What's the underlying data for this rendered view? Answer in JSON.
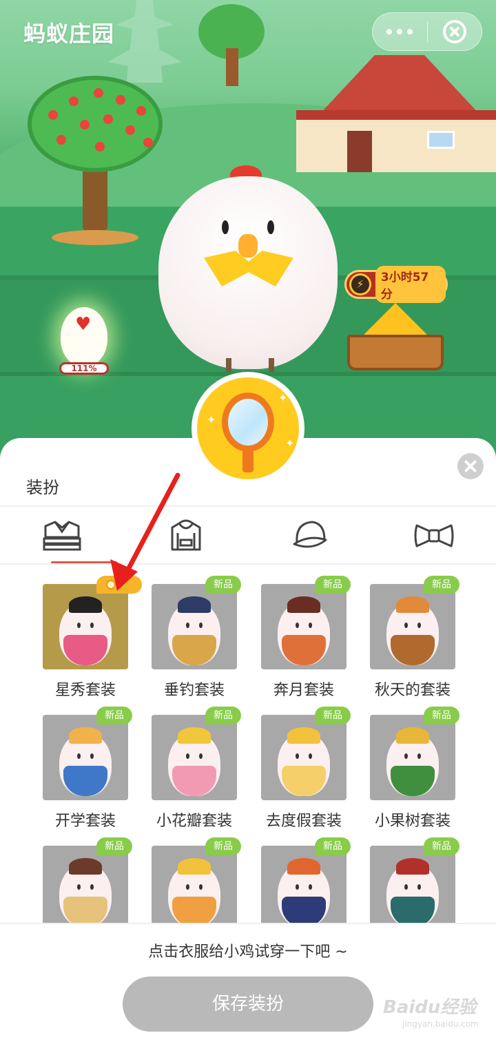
{
  "header": {
    "title": "蚂蚁庄园"
  },
  "scene": {
    "egg_progress": "111%",
    "timer_text": "3小时57分"
  },
  "sheet": {
    "title": "装扮",
    "tabs": [
      {
        "name": "outfit-tab",
        "icon": "shirt-stack-icon",
        "active": true
      },
      {
        "name": "top-tab",
        "icon": "hoodie-icon",
        "active": false
      },
      {
        "name": "hat-tab",
        "icon": "cap-icon",
        "active": false
      },
      {
        "name": "bow-tab",
        "icon": "bowtie-icon",
        "active": false
      }
    ],
    "items": [
      {
        "label": "星秀套装",
        "badge": "",
        "selected": true
      },
      {
        "label": "垂钓套装",
        "badge": "新品"
      },
      {
        "label": "奔月套装",
        "badge": "新品"
      },
      {
        "label": "秋天的套装",
        "badge": "新品"
      },
      {
        "label": "开学套装",
        "badge": "新品"
      },
      {
        "label": "小花瓣套装",
        "badge": "新品"
      },
      {
        "label": "去度假套装",
        "badge": "新品"
      },
      {
        "label": "小果树套装",
        "badge": "新品"
      },
      {
        "label": "",
        "badge": "新品"
      },
      {
        "label": "",
        "badge": "新品"
      },
      {
        "label": "",
        "badge": "新品"
      },
      {
        "label": "",
        "badge": "新品"
      }
    ]
  },
  "footer": {
    "hint": "点击衣服给小鸡试穿一下吧 ~",
    "save_label": "保存装扮"
  },
  "watermark": {
    "main": "Baidu经验",
    "sub": "jingyan.baidu.com"
  }
}
